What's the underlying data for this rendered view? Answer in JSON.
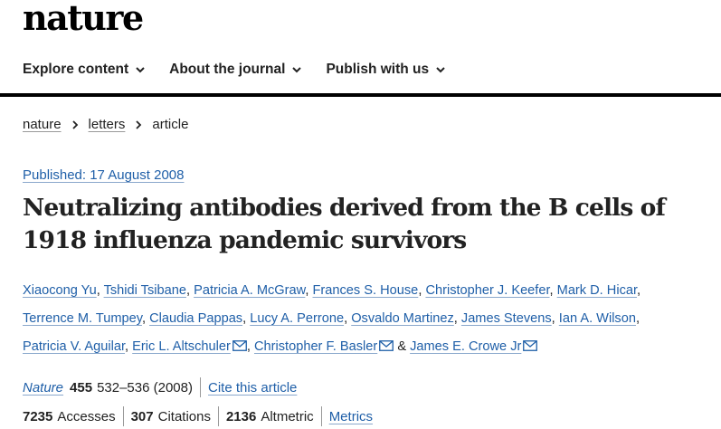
{
  "site": {
    "logo_text": "nature"
  },
  "nav": {
    "items": [
      {
        "label": "Explore content"
      },
      {
        "label": "About the journal"
      },
      {
        "label": "Publish with us"
      }
    ]
  },
  "breadcrumb": {
    "items": [
      "nature",
      "letters",
      "article"
    ]
  },
  "article": {
    "published": "Published: 17 August 2008",
    "title": "Neutralizing antibodies derived from the B cells of 1918 influenza pandemic survivors",
    "authors": [
      "Xiaocong Yu",
      "Tshidi Tsibane",
      "Patricia A. McGraw",
      "Frances S. House",
      "Christopher J. Keefer",
      "Mark D. Hicar",
      "Terrence M. Tumpey",
      "Claudia Pappas",
      "Lucy A. Perrone",
      "Osvaldo Martinez",
      "James Stevens",
      "Ian A. Wilson",
      "Patricia V. Aguilar",
      "Eric L. Altschuler",
      "Christopher F. Basler",
      "James E. Crowe Jr"
    ],
    "separator_comma": ",",
    "separator_and": "&",
    "citation": {
      "journal": "Nature",
      "volume": "455",
      "pages": "532–536 (2008)",
      "cite_label": "Cite this article"
    },
    "metrics": {
      "accesses_count": "7235",
      "accesses_label": "Accesses",
      "citations_count": "307",
      "citations_label": "Citations",
      "altmetric_count": "2136",
      "altmetric_label": "Altmetric",
      "metrics_link": "Metrics"
    }
  },
  "colors": {
    "link": "#1f5fa8",
    "text": "#222222",
    "rule": "#000000"
  },
  "icons": {
    "nav_chevron": "chevron-down-icon",
    "breadcrumb_sep": "chevron-right-icon",
    "mail": "mail-icon"
  }
}
